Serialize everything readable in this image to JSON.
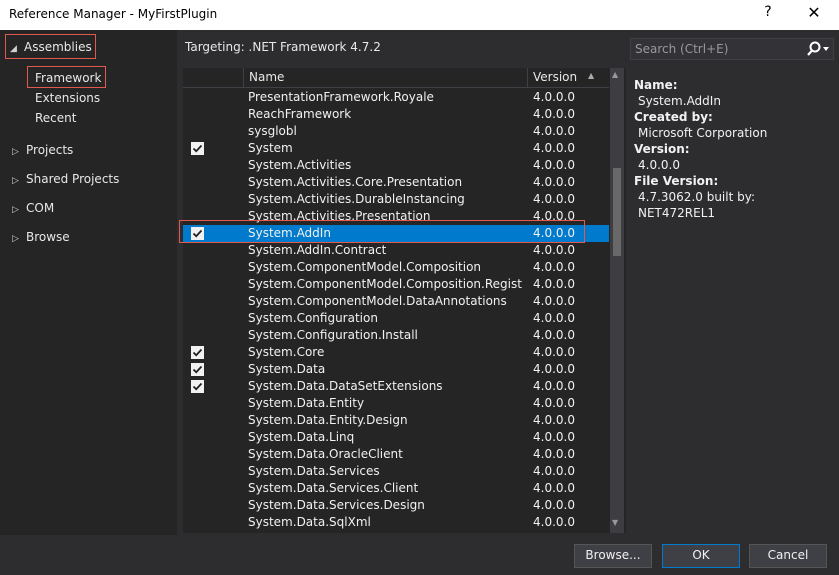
{
  "window": {
    "title": "Reference Manager - MyFirstPlugin",
    "help": "?",
    "close": "✕"
  },
  "nav": {
    "assemblies": "Assemblies",
    "framework": "Framework",
    "extensions": "Extensions",
    "recent": "Recent",
    "projects": "Projects",
    "shared_projects": "Shared Projects",
    "com": "COM",
    "browse": "Browse"
  },
  "targeting": "Targeting: .NET Framework 4.7.2",
  "search": {
    "placeholder": "Search (Ctrl+E)"
  },
  "columns": {
    "name": "Name",
    "version": "Version"
  },
  "rows": [
    {
      "name": "PresentationFramework.Royale",
      "version": "4.0.0.0",
      "checked": false
    },
    {
      "name": "ReachFramework",
      "version": "4.0.0.0",
      "checked": false
    },
    {
      "name": "sysglobl",
      "version": "4.0.0.0",
      "checked": false
    },
    {
      "name": "System",
      "version": "4.0.0.0",
      "checked": true
    },
    {
      "name": "System.Activities",
      "version": "4.0.0.0",
      "checked": false
    },
    {
      "name": "System.Activities.Core.Presentation",
      "version": "4.0.0.0",
      "checked": false
    },
    {
      "name": "System.Activities.DurableInstancing",
      "version": "4.0.0.0",
      "checked": false
    },
    {
      "name": "System.Activities.Presentation",
      "version": "4.0.0.0",
      "checked": false
    },
    {
      "name": "System.AddIn",
      "version": "4.0.0.0",
      "checked": true,
      "selected": true
    },
    {
      "name": "System.AddIn.Contract",
      "version": "4.0.0.0",
      "checked": false
    },
    {
      "name": "System.ComponentModel.Composition",
      "version": "4.0.0.0",
      "checked": false
    },
    {
      "name": "System.ComponentModel.Composition.Regist...",
      "version": "4.0.0.0",
      "checked": false
    },
    {
      "name": "System.ComponentModel.DataAnnotations",
      "version": "4.0.0.0",
      "checked": false
    },
    {
      "name": "System.Configuration",
      "version": "4.0.0.0",
      "checked": false
    },
    {
      "name": "System.Configuration.Install",
      "version": "4.0.0.0",
      "checked": false
    },
    {
      "name": "System.Core",
      "version": "4.0.0.0",
      "checked": true
    },
    {
      "name": "System.Data",
      "version": "4.0.0.0",
      "checked": true
    },
    {
      "name": "System.Data.DataSetExtensions",
      "version": "4.0.0.0",
      "checked": true
    },
    {
      "name": "System.Data.Entity",
      "version": "4.0.0.0",
      "checked": false
    },
    {
      "name": "System.Data.Entity.Design",
      "version": "4.0.0.0",
      "checked": false
    },
    {
      "name": "System.Data.Linq",
      "version": "4.0.0.0",
      "checked": false
    },
    {
      "name": "System.Data.OracleClient",
      "version": "4.0.0.0",
      "checked": false
    },
    {
      "name": "System.Data.Services",
      "version": "4.0.0.0",
      "checked": false
    },
    {
      "name": "System.Data.Services.Client",
      "version": "4.0.0.0",
      "checked": false
    },
    {
      "name": "System.Data.Services.Design",
      "version": "4.0.0.0",
      "checked": false
    },
    {
      "name": "System.Data.SqlXml",
      "version": "4.0.0.0",
      "checked": false
    }
  ],
  "details": {
    "name_label": "Name:",
    "name_value": "System.AddIn",
    "created_label": "Created by:",
    "created_value": "Microsoft Corporation",
    "version_label": "Version:",
    "version_value": "4.0.0.0",
    "file_version_label": "File Version:",
    "file_version_value": "4.7.3062.0 built by: NET472REL1"
  },
  "buttons": {
    "browse": "Browse...",
    "ok": "OK",
    "cancel": "Cancel"
  },
  "colors": {
    "selection": "#007acc",
    "highlight_box": "#e05a4f",
    "background": "#2d2d30"
  }
}
